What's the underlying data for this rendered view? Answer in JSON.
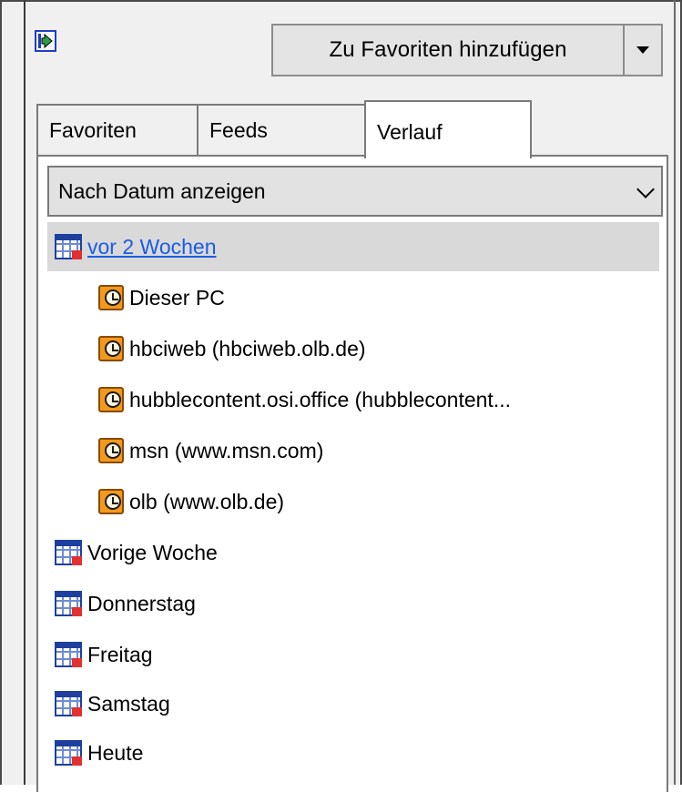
{
  "toolbar": {
    "dock_icon": "pin-dock-icon",
    "add_favorites_label": "Zu Favoriten hinzufügen",
    "dropdown_icon": "caret-down-icon"
  },
  "tabs": [
    {
      "label": "Favoriten",
      "active": false
    },
    {
      "label": "Feeds",
      "active": false
    },
    {
      "label": "Verlauf",
      "active": true
    }
  ],
  "view_select": {
    "value": "Nach Datum anzeigen"
  },
  "history": {
    "groups": [
      {
        "label": "vor 2 Wochen",
        "expanded": true,
        "selected": true,
        "icon": "calendar-icon",
        "sites": [
          {
            "label": "Dieser PC",
            "icon": "history-site-icon"
          },
          {
            "label": "hbciweb (hbciweb.olb.de)",
            "icon": "history-site-icon"
          },
          {
            "label": "hubblecontent.osi.office (hubblecontent...",
            "icon": "history-site-icon"
          },
          {
            "label": "msn (www.msn.com)",
            "icon": "history-site-icon"
          },
          {
            "label": "olb (www.olb.de)",
            "icon": "history-site-icon"
          }
        ]
      },
      {
        "label": "Vorige Woche",
        "icon": "calendar-icon"
      },
      {
        "label": "Donnerstag",
        "icon": "calendar-icon"
      },
      {
        "label": "Freitag",
        "icon": "calendar-icon"
      },
      {
        "label": "Samstag",
        "icon": "calendar-icon"
      },
      {
        "label": "Heute",
        "icon": "calendar-icon"
      }
    ]
  },
  "colors": {
    "link": "#1a5ce6",
    "selected_row": "#d9d9d9",
    "calendar_blue": "#1e3f9e",
    "history_orange": "#f39a1b"
  }
}
